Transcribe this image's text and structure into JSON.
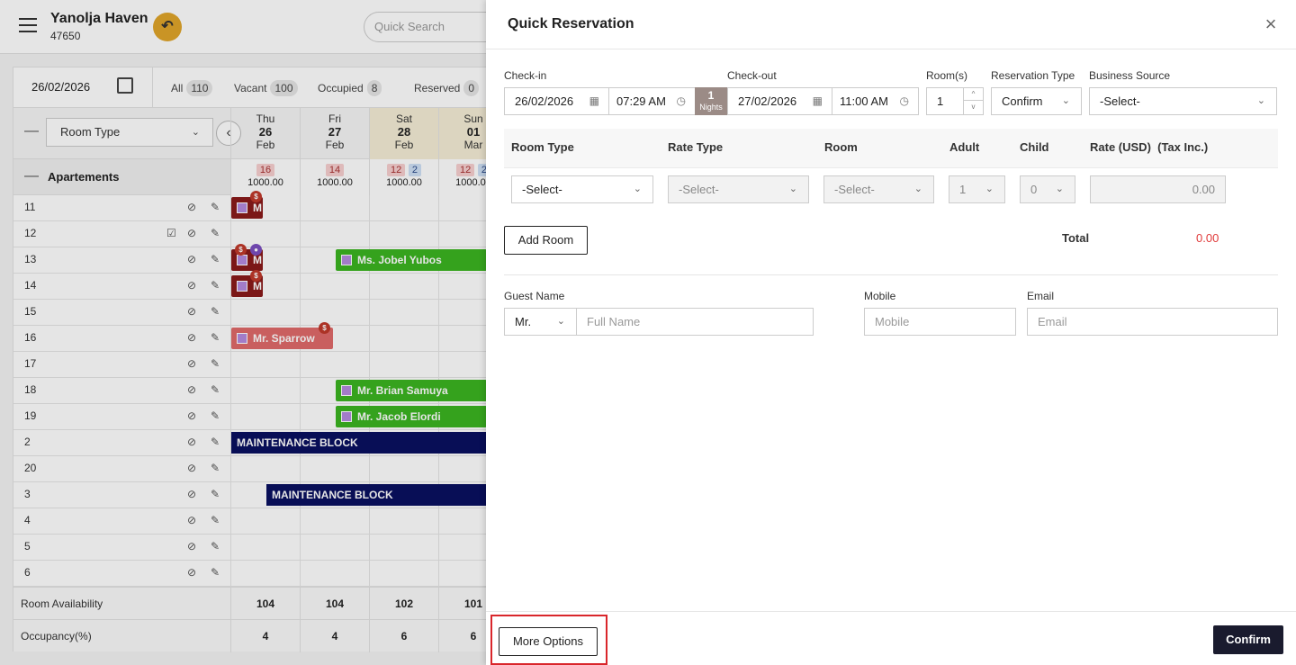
{
  "app": {
    "hotel_name": "Yanolja Haven",
    "hotel_id": "47650",
    "quick_search_placeholder": "Quick Search"
  },
  "calendar": {
    "date": "26/02/2026",
    "stats": [
      {
        "label": "All",
        "count": "110"
      },
      {
        "label": "Vacant",
        "count": "100"
      },
      {
        "label": "Occupied",
        "count": "8"
      },
      {
        "label": "Reserved",
        "count": "0"
      }
    ],
    "room_type_filter": "Room Type",
    "days": [
      {
        "name": "Thu",
        "day": "26",
        "month": "Feb",
        "weekend": false
      },
      {
        "name": "Fri",
        "day": "27",
        "month": "Feb",
        "weekend": false
      },
      {
        "name": "Sat",
        "day": "28",
        "month": "Feb",
        "weekend": true
      },
      {
        "name": "Sun",
        "day": "01",
        "month": "Mar",
        "weekend": true
      }
    ],
    "group": {
      "name": "Apartements",
      "cells": [
        {
          "pills": [
            {
              "v": "16",
              "c": "red"
            }
          ],
          "amount": "1000.00"
        },
        {
          "pills": [
            {
              "v": "14",
              "c": "red"
            }
          ],
          "amount": "1000.00"
        },
        {
          "pills": [
            {
              "v": "12",
              "c": "red"
            },
            {
              "v": "2",
              "c": "blue"
            }
          ],
          "amount": "1000.00"
        },
        {
          "pills": [
            {
              "v": "12",
              "c": "red"
            },
            {
              "v": "2",
              "c": "blue"
            }
          ],
          "amount": "1000.00"
        }
      ]
    },
    "rooms": [
      "11",
      "12",
      "13",
      "14",
      "15",
      "16",
      "17",
      "18",
      "19",
      "2",
      "20",
      "3",
      "4",
      "5",
      "6"
    ],
    "bookings": {
      "b1": "Ms. Jobel Yubos",
      "b2": "Mr. Sparrow",
      "b3": "Mr. Brian Samuya",
      "b4": "Mr. Jacob Elordi",
      "b5": "MAINTENANCE BLOCK",
      "b6": "MAINTENANCE BLOCK",
      "m1": "M",
      "m2": "M",
      "m3": "M"
    },
    "footer": {
      "availability_label": "Room Availability",
      "availability": [
        "104",
        "104",
        "102",
        "101"
      ],
      "occupancy_label": "Occupancy(%)",
      "occupancy": [
        "4",
        "4",
        "6",
        "6"
      ]
    }
  },
  "drawer": {
    "title": "Quick Reservation",
    "checkin": {
      "label": "Check-in",
      "date": "26/02/2026",
      "time": "07:29 AM"
    },
    "nights": {
      "count": "1",
      "label": "Nights"
    },
    "checkout": {
      "label": "Check-out",
      "date": "27/02/2026",
      "time": "11:00 AM"
    },
    "rooms": {
      "label": "Room(s)",
      "value": "1"
    },
    "reservation_type": {
      "label": "Reservation Type",
      "value": "Confirm"
    },
    "business_source": {
      "label": "Business Source",
      "value": "-Select-"
    },
    "table": {
      "headers": [
        "Room Type",
        "Rate Type",
        "Room",
        "Adult",
        "Child",
        "Rate (USD)  (Tax Inc.)"
      ],
      "row": {
        "room_type": "-Select-",
        "rate_type": "-Select-",
        "room": "-Select-",
        "adult": "1",
        "child": "0",
        "rate": "0.00"
      }
    },
    "add_room": "Add Room",
    "total_label": "Total",
    "total_value": "0.00",
    "guest": {
      "name_label": "Guest Name",
      "salutation": "Mr.",
      "name_placeholder": "Full Name",
      "mobile_label": "Mobile",
      "mobile_placeholder": "Mobile",
      "email_label": "Email",
      "email_placeholder": "Email"
    },
    "more_options": "More Options",
    "confirm": "Confirm"
  },
  "colors": {
    "accent_dark": "#1a1b2e",
    "highlight_red": "#d9262b",
    "total_red": "#e03a3a",
    "booking_green": "#3cb521",
    "maintenance_navy": "#0a1060"
  }
}
